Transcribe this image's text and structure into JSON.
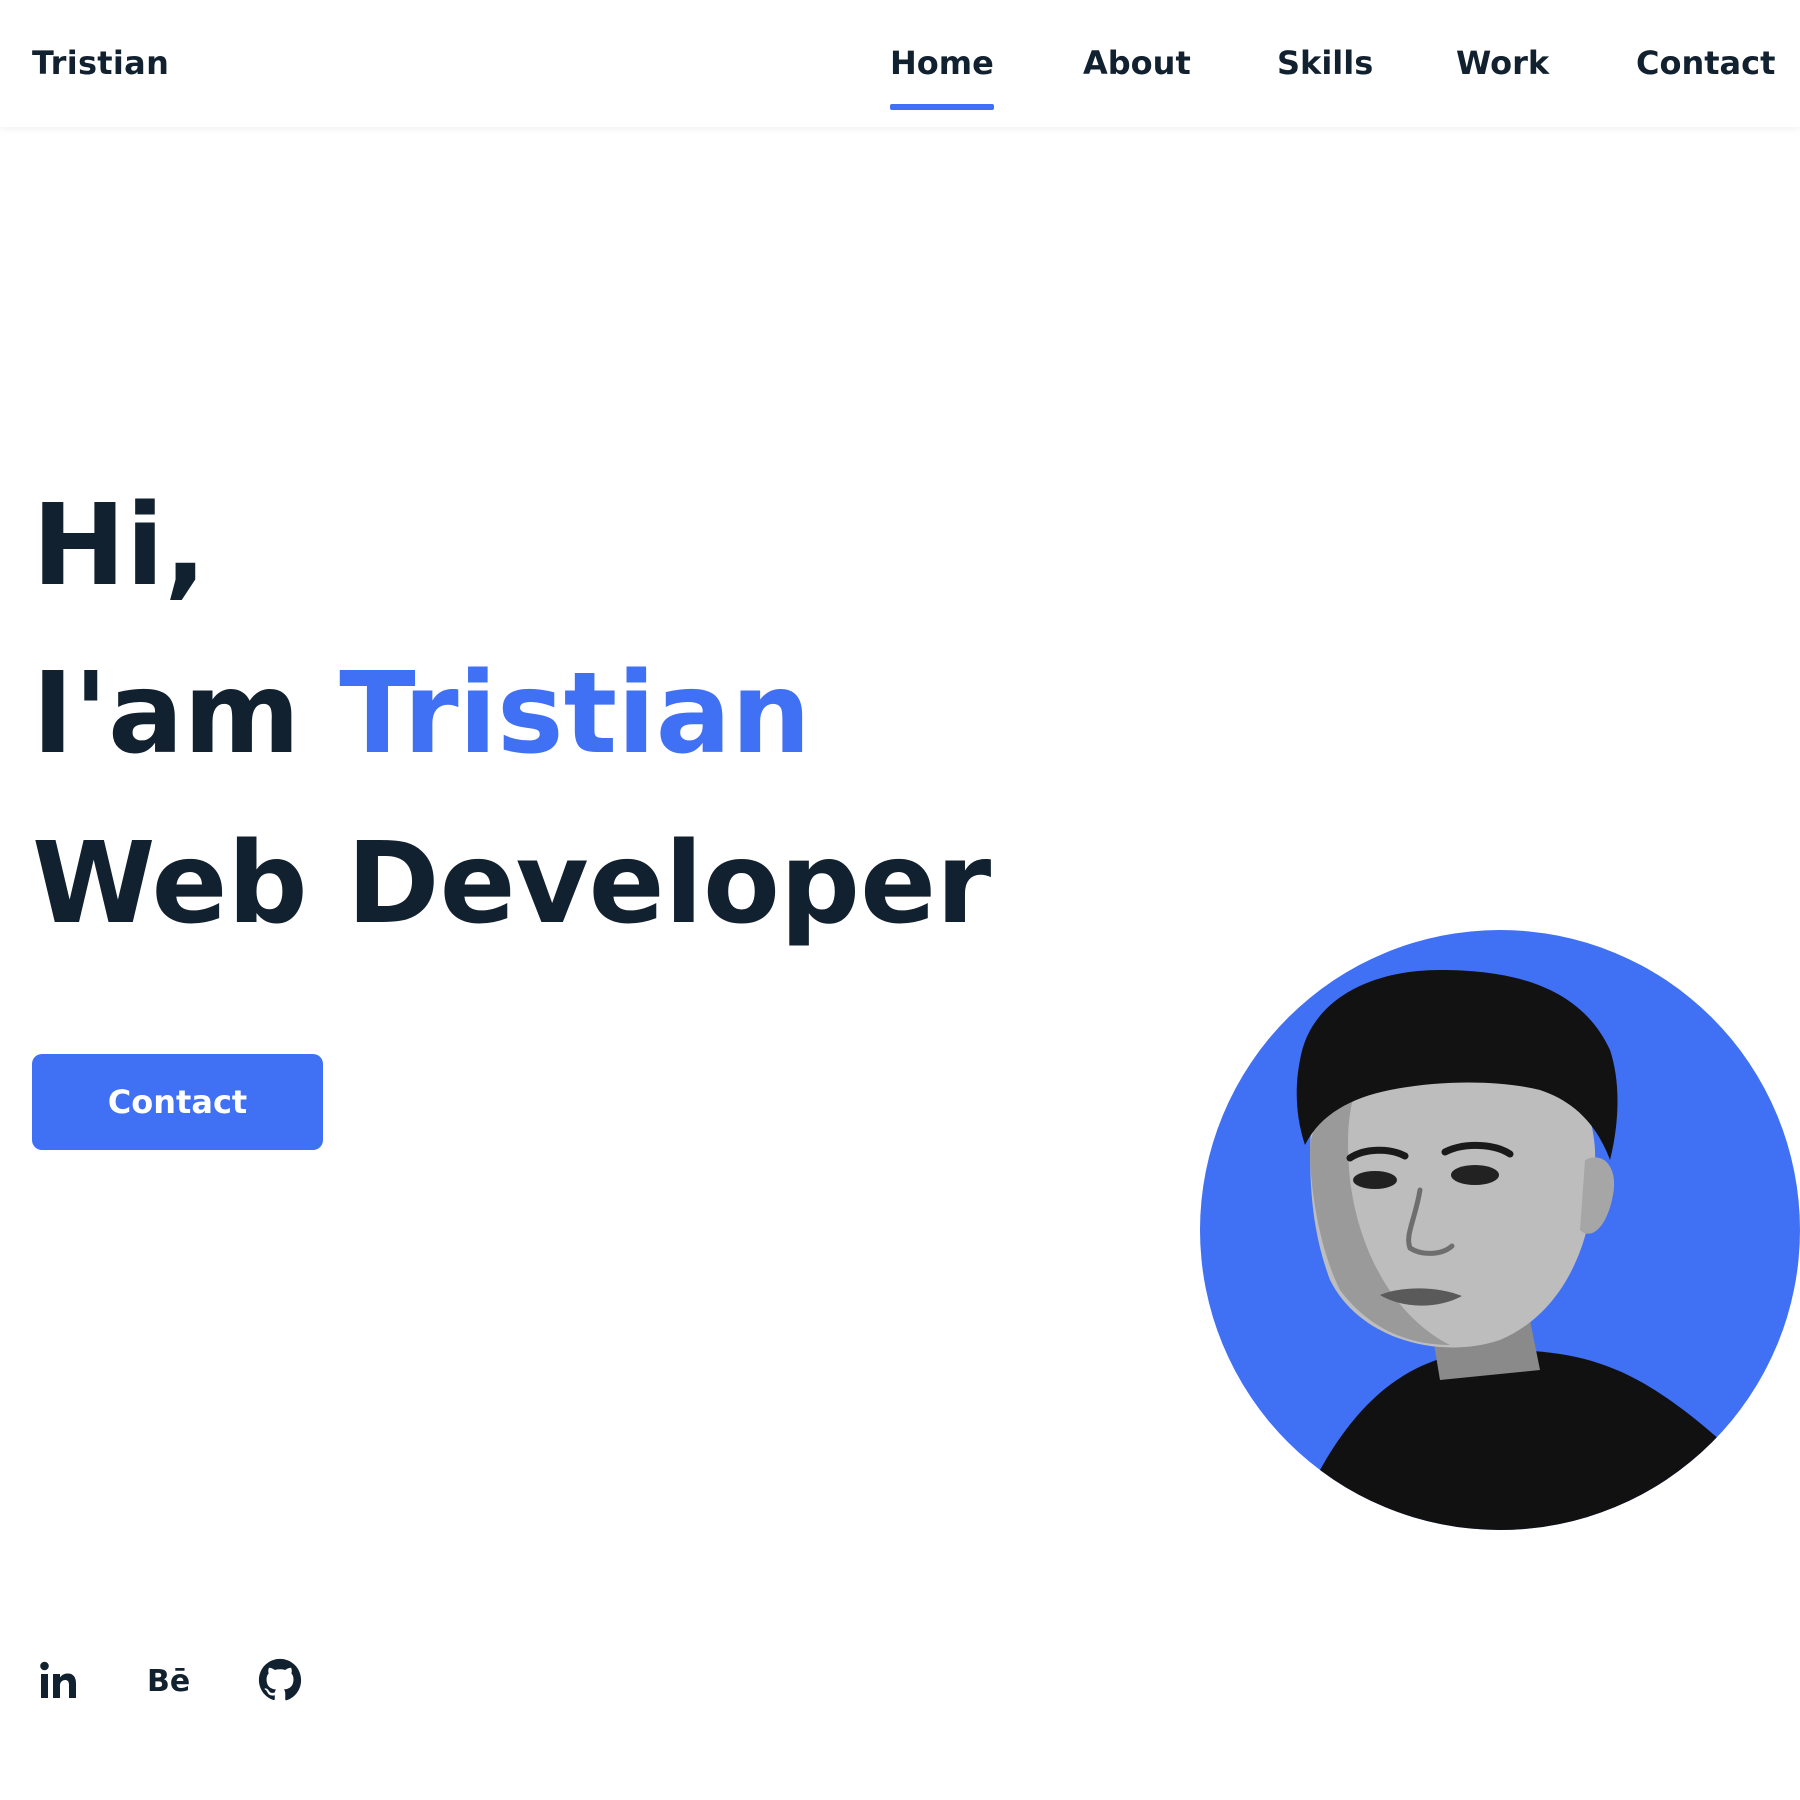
{
  "header": {
    "logo": "Tristian",
    "nav": [
      {
        "label": "Home",
        "active": true
      },
      {
        "label": "About",
        "active": false
      },
      {
        "label": "Skills",
        "active": false
      },
      {
        "label": "Work",
        "active": false
      },
      {
        "label": "Contact",
        "active": false
      }
    ]
  },
  "hero": {
    "greeting": "Hi,",
    "intro_prefix": "I'am",
    "name": "Tristian",
    "role": "Web Developer",
    "cta_label": "Contact"
  },
  "social": [
    {
      "icon": "linkedin-icon",
      "label": "in"
    },
    {
      "icon": "behance-icon",
      "label": "Bē"
    },
    {
      "icon": "github-icon",
      "label": ""
    }
  ],
  "colors": {
    "accent": "#4070f4",
    "text": "#12212f",
    "background": "#ffffff"
  }
}
